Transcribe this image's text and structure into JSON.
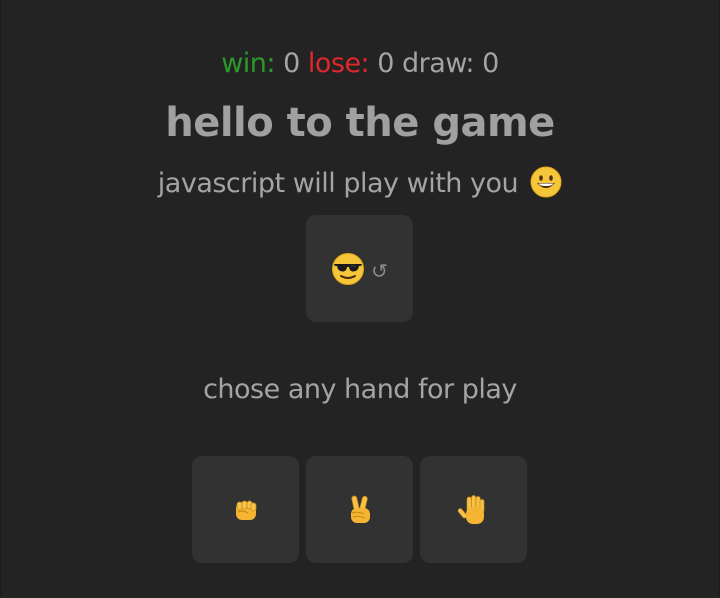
{
  "score": {
    "win_label": "win:",
    "win_value": "0",
    "lose_label": "lose:",
    "lose_value": "0",
    "draw_label": "draw:",
    "draw_value": "0"
  },
  "title": "hello to the game",
  "subtitle": "javascript will play with you",
  "result": {
    "computer_icon": "sunglasses-face-icon",
    "reload_glyph": "↺"
  },
  "prompt": "chose any hand for play",
  "hands": [
    {
      "icon": "rock-fist-icon"
    },
    {
      "icon": "scissors-victory-hand-icon"
    },
    {
      "icon": "paper-raised-hand-icon"
    }
  ],
  "colors": {
    "background": "#232323",
    "panel": "#323232",
    "text": "#a4a4a4",
    "win": "#2a9a2a",
    "lose": "#e0282a"
  }
}
